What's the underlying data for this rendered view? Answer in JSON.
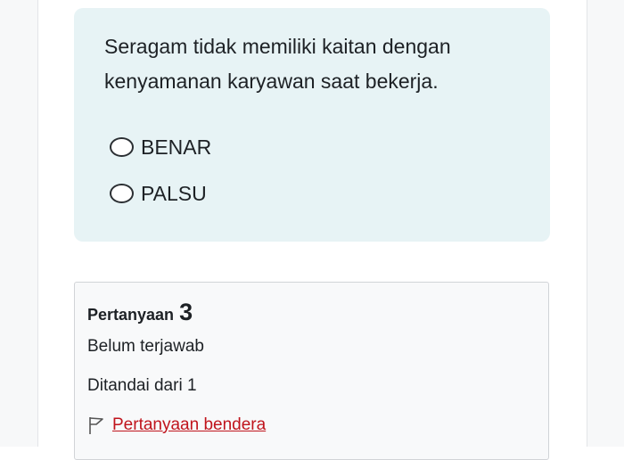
{
  "question": {
    "text": "Seragam tidak memiliki kaitan dengan kenyamanan karyawan saat bekerja.",
    "options": [
      {
        "label": "BENAR",
        "selected": false
      },
      {
        "label": "PALSU",
        "selected": false
      }
    ]
  },
  "info": {
    "question_word": "Pertanyaan",
    "question_number": "3",
    "status": "Belum terjawab",
    "marks": "Ditandai dari 1",
    "flag_icon": "flag-outline-icon",
    "flag_label": "Pertanyaan bendera",
    "flag_color": "#c0141c"
  }
}
